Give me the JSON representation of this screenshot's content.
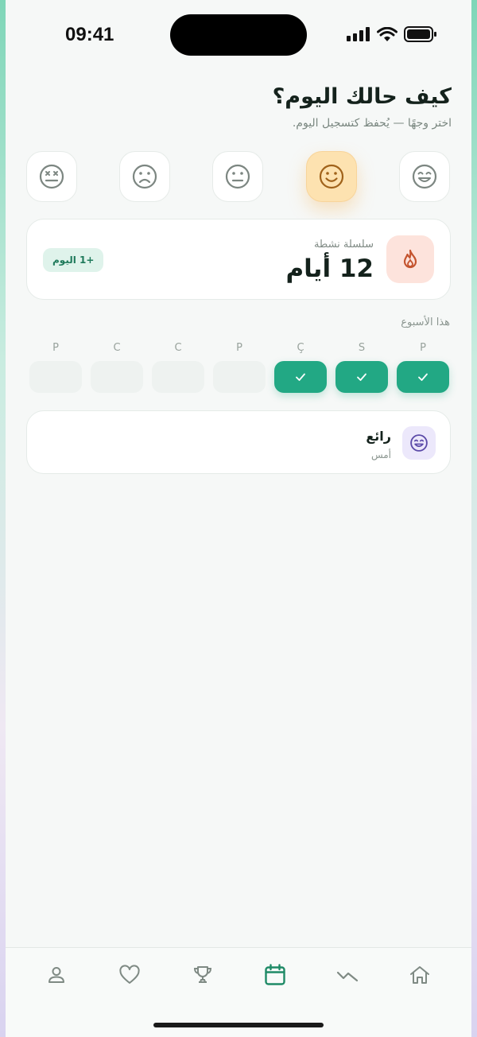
{
  "status_bar": {
    "time": "09:41"
  },
  "header": {
    "title": "كيف حالك اليوم؟",
    "subtitle": "اختر وجهًا — يُحفظ كتسجيل اليوم."
  },
  "moods": [
    {
      "icon": "laughing-face-icon"
    },
    {
      "icon": "smiling-face-icon",
      "selected": true
    },
    {
      "icon": "neutral-face-icon"
    },
    {
      "icon": "sad-face-icon"
    },
    {
      "icon": "dizzy-face-icon"
    }
  ],
  "streak": {
    "label": "سلسلة نشطة",
    "value": "12 أيام",
    "badge": "+1 اليوم",
    "icon": "flame-icon"
  },
  "week": {
    "label": "هذا الأسبوع",
    "days": [
      {
        "letter": "P",
        "done": true
      },
      {
        "letter": "S",
        "done": true
      },
      {
        "letter": "Ç",
        "done": true
      },
      {
        "letter": "P",
        "done": false
      },
      {
        "letter": "C",
        "done": false
      },
      {
        "letter": "C",
        "done": false
      },
      {
        "letter": "P",
        "done": false
      }
    ]
  },
  "recent_entry": {
    "mood": "رائع",
    "date": "أمس",
    "icon": "laughing-face-icon"
  },
  "tabbar": {
    "active": "calendar",
    "items": [
      "home-icon",
      "trend-icon",
      "calendar-icon",
      "trophy-icon",
      "heart-icon",
      "profile-icon"
    ]
  },
  "colors": {
    "accent": "#22a884",
    "selected_mood": "#fde2b0",
    "flame_bg": "#fde3dc",
    "entry_icon_bg": "#ece8fb"
  }
}
